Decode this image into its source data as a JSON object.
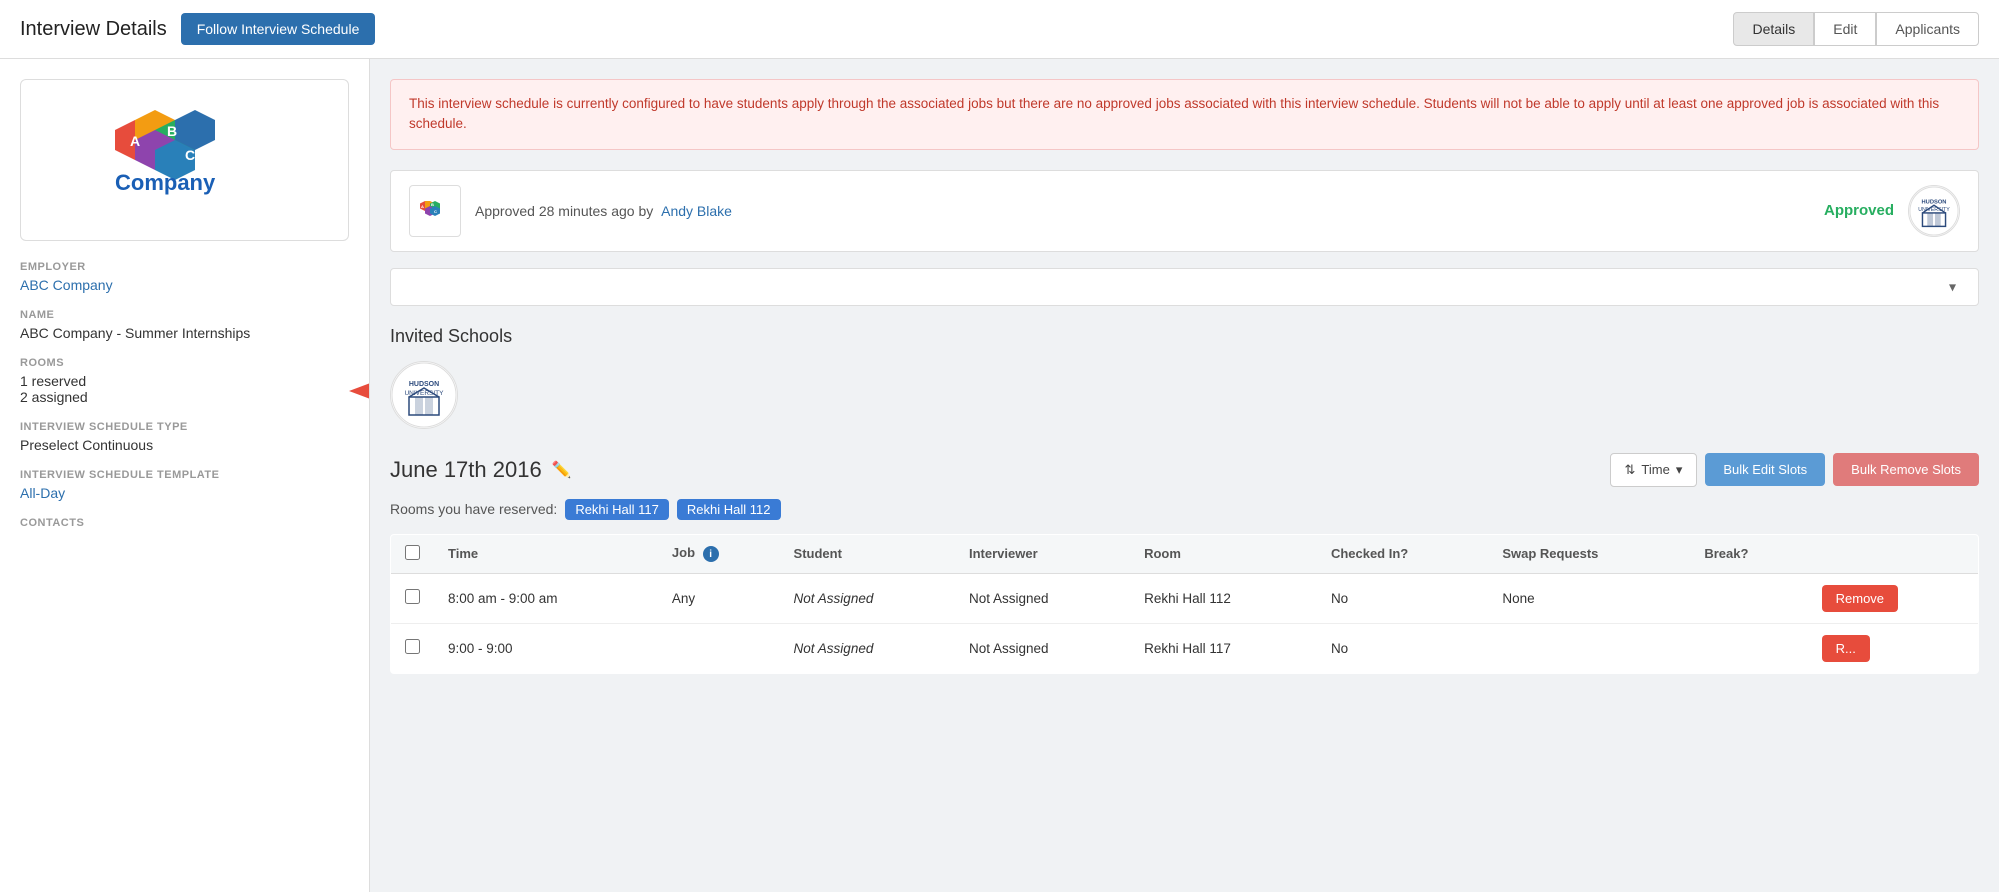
{
  "header": {
    "title": "Interview Details",
    "follow_btn": "Follow Interview Schedule",
    "nav": {
      "details": "Details",
      "edit": "Edit",
      "applicants": "Applicants"
    }
  },
  "sidebar": {
    "employer_label": "EMPLOYER",
    "employer_value": "ABC Company",
    "name_label": "NAME",
    "name_value": "ABC Company - Summer Internships",
    "rooms_label": "ROOMS",
    "rooms_line1": "1 reserved",
    "rooms_line2": "2 assigned",
    "schedule_type_label": "INTERVIEW SCHEDULE TYPE",
    "schedule_type_value": "Preselect Continuous",
    "template_label": "INTERVIEW SCHEDULE TEMPLATE",
    "template_value": "All-Day",
    "contacts_label": "CONTACTS"
  },
  "alert": {
    "message": "This interview schedule is currently configured to have students apply through the associated jobs but there are no approved jobs associated with this interview schedule. Students will not be able to apply until at least one approved job is associated with this schedule."
  },
  "approved_card": {
    "approved_text": "Approved 28 minutes ago by",
    "approver_name": "Andy Blake",
    "status": "Approved"
  },
  "invited_schools": {
    "title": "Invited Schools"
  },
  "date_section": {
    "date": "June 17th 2016",
    "rooms_reserved_label": "Rooms you have reserved:",
    "room1": "Rekhi Hall 117",
    "room2": "Rekhi Hall 112",
    "sort_btn": "Time",
    "bulk_edit_btn": "Bulk Edit Slots",
    "bulk_remove_btn": "Bulk Remove Slots"
  },
  "table": {
    "headers": [
      "",
      "Time",
      "Job",
      "Student",
      "Interviewer",
      "Room",
      "Checked In?",
      "Swap Requests",
      "Break?",
      ""
    ],
    "rows": [
      {
        "time": "8:00 am - 9:00 am",
        "job": "Any",
        "student": "Not Assigned",
        "interviewer": "Not Assigned",
        "room": "Rekhi Hall 112",
        "checked_in": "No",
        "swap_requests": "None",
        "break": "",
        "action": "Remove"
      },
      {
        "time": "9:00 - 9:00",
        "job": "",
        "student": "Not Assigned",
        "interviewer": "Not Assigned",
        "room": "Rekhi Hall 117",
        "checked_in": "No",
        "swap_requests": "",
        "break": "",
        "action": "R..."
      }
    ]
  }
}
